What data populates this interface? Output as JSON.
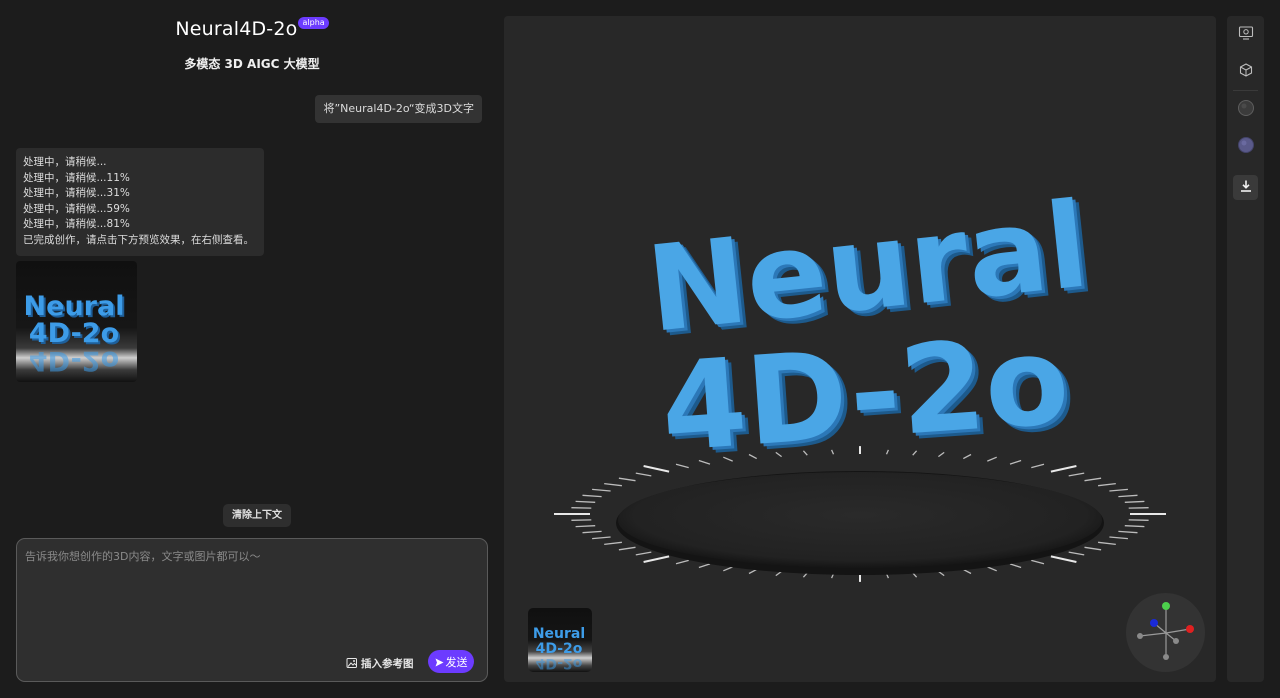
{
  "header": {
    "title": "Neural4D-2o",
    "badge": "alpha",
    "subtitle": "多模态 3D AIGC 大模型"
  },
  "chat": {
    "user_message": "将”Neural4D-2o“变成3D文字",
    "bot_lines": [
      "处理中，请稍候...",
      "处理中，请稍候...11%",
      "处理中，请稍候...31%",
      "处理中，请稍候...59%",
      "处理中，请稍候...81%",
      "已完成创作，请点击下方预览效果，在右侧查看。"
    ],
    "result_thumbnail_text": [
      "Neural",
      "4D-2o"
    ]
  },
  "controls": {
    "clear_context": "清除上下文",
    "input_placeholder": "告诉我你想创作的3D内容，文字或图片都可以～",
    "insert_reference": "插入参考图",
    "send": "发送"
  },
  "viewport": {
    "model_text": [
      "Neural",
      "4D-2o"
    ],
    "model_color": "#4aa6e6",
    "gizmo_axes": {
      "x": "#e02020",
      "y": "#4cd04c",
      "z": "#1a2ad8"
    }
  },
  "toolbar": {
    "icons": [
      "monitor-icon",
      "model-icon",
      "dark-material-icon",
      "purple-material-icon",
      "download-icon"
    ]
  },
  "theme": {
    "accent": "#6c3bff",
    "background": "#1c1c1c",
    "panel": "#282828"
  }
}
